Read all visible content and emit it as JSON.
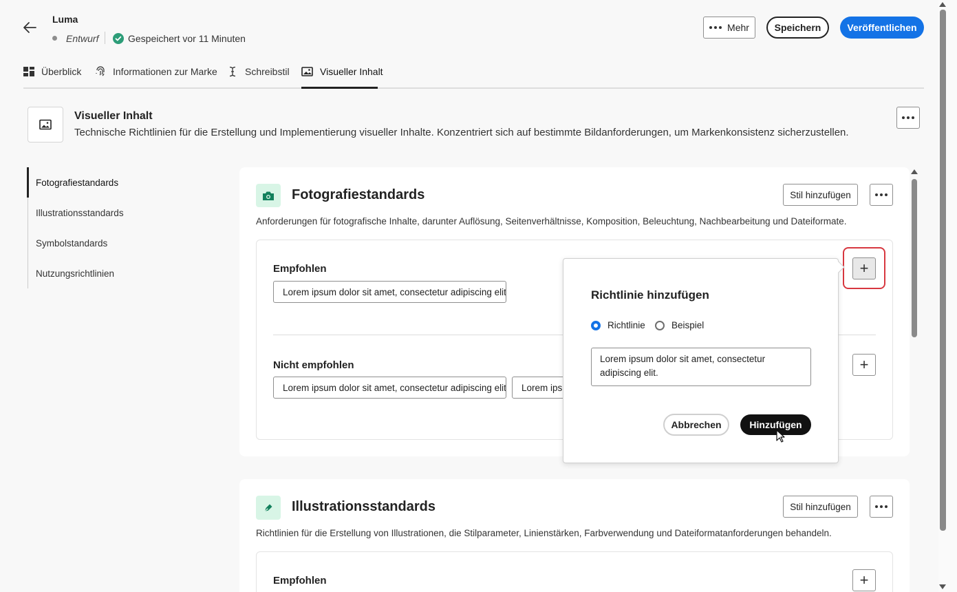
{
  "header": {
    "title": "Luma",
    "status": "Entwurf",
    "saved": "Gespeichert vor 11 Minuten",
    "more_label": "Mehr",
    "save_label": "Speichern",
    "publish_label": "Veröffentlichen"
  },
  "tabs": [
    {
      "label": "Überblick",
      "icon": "dashboard-icon"
    },
    {
      "label": "Informationen zur Marke",
      "icon": "fingerprint-icon"
    },
    {
      "label": "Schreibstil",
      "icon": "text-cursor-icon"
    },
    {
      "label": "Visueller Inhalt",
      "icon": "image-icon",
      "active": true
    }
  ],
  "section": {
    "title": "Visueller Inhalt",
    "description": "Technische Richtlinien für die Erstellung und Implementierung visueller Inhalte. Konzentriert sich auf bestimmte Bildanforderungen, um Markenkonsistenz sicherzustellen."
  },
  "sidenav": [
    {
      "label": "Fotografiestandards",
      "active": true
    },
    {
      "label": "Illustrationsstandards"
    },
    {
      "label": "Symbolstandards"
    },
    {
      "label": "Nutzungsrichtlinien"
    }
  ],
  "photo_card": {
    "title": "Fotografiestandards",
    "description": "Anforderungen für fotografische Inhalte, darunter Auflösung, Seitenverhältnisse, Komposition, Beleuchtung, Nachbearbeitung und Dateiformate.",
    "add_style_label": "Stil hinzufügen",
    "recommended_label": "Empfohlen",
    "recommended_items": [
      "Lorem ipsum dolor sit amet, consectetur adipiscing elit."
    ],
    "not_recommended_label": "Nicht empfohlen",
    "not_recommended_items": [
      "Lorem ipsum dolor sit amet, consectetur adipiscing elit.",
      "Lorem ipsum dolor sit amet, consectetur adipiscing elit."
    ]
  },
  "illustration_card": {
    "title": "Illustrationsstandards",
    "description": "Richtlinien für die Erstellung von Illustrationen, die Stilparameter, Linienstärken, Farbverwendung und Dateiformatanforderungen behandeln.",
    "add_style_label": "Stil hinzufügen",
    "recommended_label": "Empfohlen"
  },
  "dialog": {
    "title": "Richtlinie hinzufügen",
    "option_guideline": "Richtlinie",
    "option_example": "Beispiel",
    "selected_option": "Richtlinie",
    "text_value": "Lorem ipsum dolor sit amet, consectetur adipiscing elit.",
    "cancel_label": "Abbrechen",
    "add_label": "Hinzufügen"
  },
  "colors": {
    "accent": "#1473e6",
    "photo_icon_bg": "#d8f5e6",
    "photo_icon": "#12805c",
    "highlight": "#d7373f",
    "success": "#2d9d78"
  }
}
